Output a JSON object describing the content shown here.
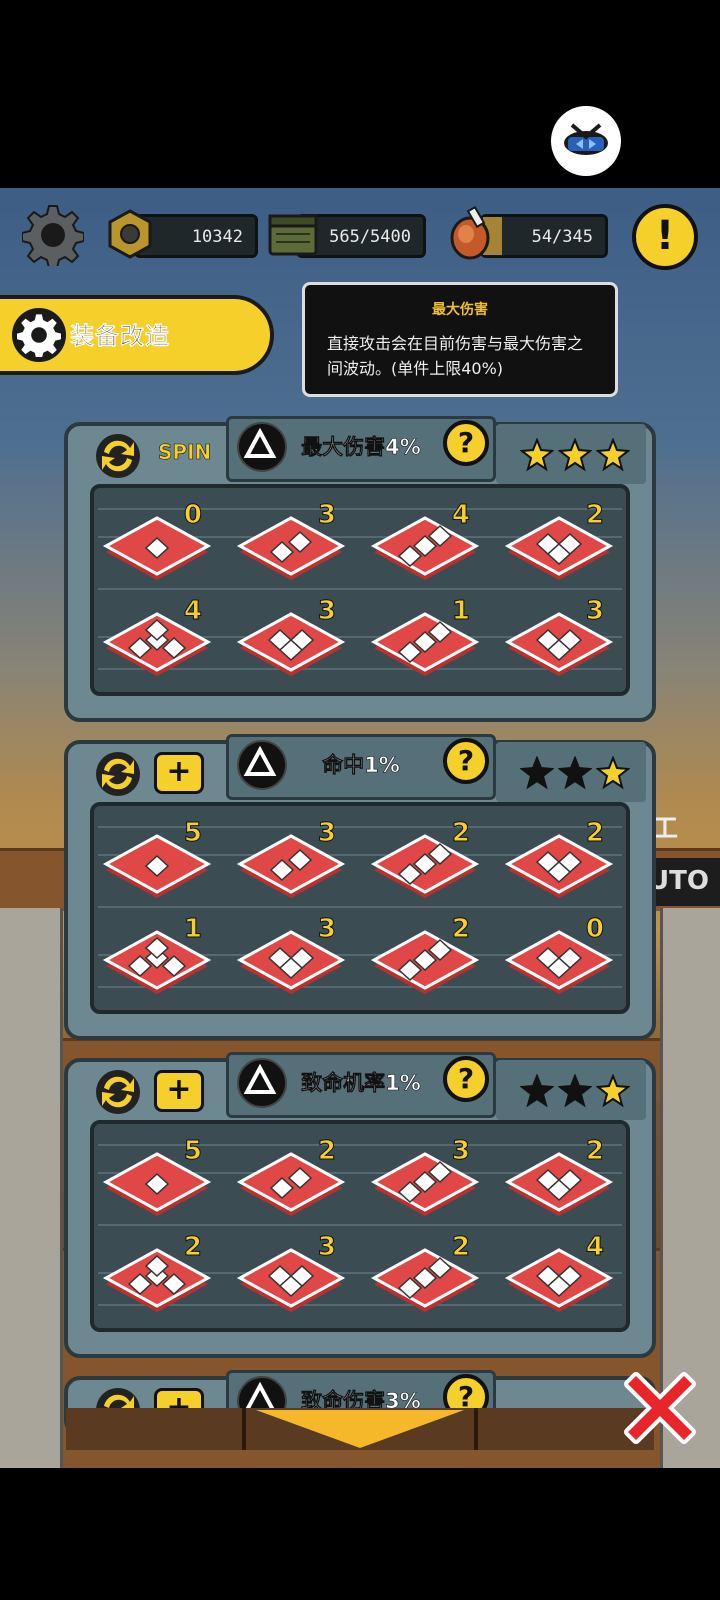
{
  "resources": {
    "bolts": {
      "value": "10342",
      "icon": "nut-icon"
    },
    "ammo": {
      "value": "565/5400",
      "icon": "ammo-crate-icon",
      "fill": 0.105
    },
    "food": {
      "value": "54/345",
      "icon": "meat-icon",
      "fill": 0.157
    }
  },
  "banner": {
    "title": "装备改造"
  },
  "tooltip": {
    "title": "最大伤害",
    "body": "直接攻击会在目前伤害与最大伤害之间波动。(单件上限40%)"
  },
  "panels": [
    {
      "left_control": "SPIN",
      "title": "最大伤害4%",
      "stars_filled": 3,
      "tiles": [
        "0",
        "3",
        "4",
        "2",
        "4",
        "3",
        "1",
        "3"
      ]
    },
    {
      "left_control": "+",
      "title": "命中1%",
      "stars_filled": 1,
      "tiles": [
        "5",
        "3",
        "2",
        "2",
        "1",
        "3",
        "2",
        "0"
      ]
    },
    {
      "left_control": "+",
      "title": "致命机率1%",
      "stars_filled": 1,
      "tiles": [
        "5",
        "2",
        "3",
        "2",
        "2",
        "3",
        "2",
        "4"
      ]
    },
    {
      "left_control": "+",
      "title": "致命伤害3%"
    }
  ],
  "background_labels": {
    "auto": "UTO",
    "partial": "工"
  },
  "colors": {
    "accent": "#f5cf2a",
    "tile_red": "#e04848",
    "panel": "#6d8890",
    "close_red": "#e8262a"
  }
}
